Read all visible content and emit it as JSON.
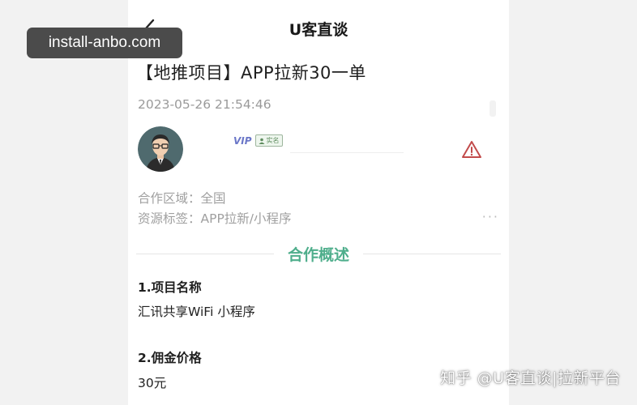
{
  "watermark": {
    "badge_text": "install-anbo.com",
    "footer_text": "知乎 @U客直谈|拉新平台"
  },
  "nav": {
    "title": "U客直谈",
    "back_icon": "chevron-left-icon"
  },
  "post": {
    "title": "【地推项目】APP拉新30一单",
    "time": "2023-05-26 21:54:46"
  },
  "user": {
    "vip_label": "VIP",
    "verified_label": "实名"
  },
  "meta": {
    "region": "合作区域：全国",
    "tags": "资源标签：APP拉新/小程序",
    "more": "···"
  },
  "section": {
    "title": "合作概述"
  },
  "fields": [
    {
      "label": "1.项目名称",
      "value": "汇讯共享WiFi 小程序"
    },
    {
      "label": "2.佣金价格",
      "value": "30元"
    }
  ],
  "colors": {
    "accent": "#4fae8c",
    "warning": "#c24b4b",
    "vip": "#6b77c8"
  }
}
